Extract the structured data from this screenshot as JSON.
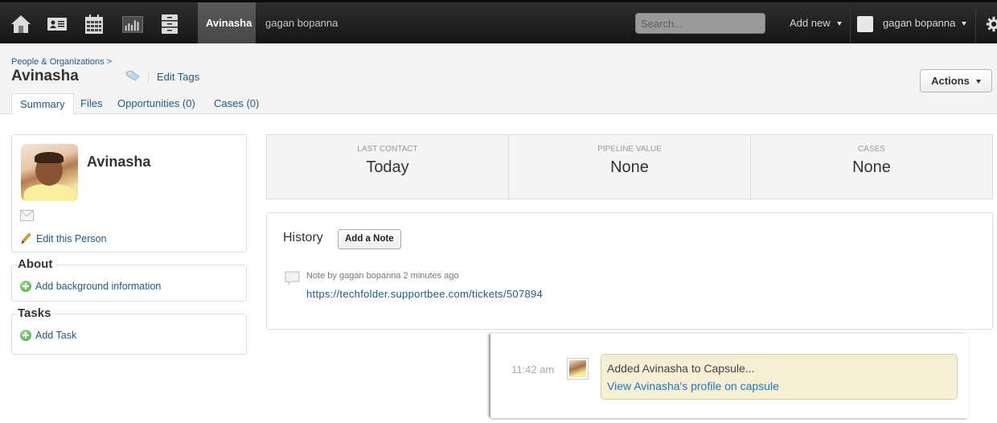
{
  "topbar": {
    "nav_icons": [
      "home-icon",
      "contacts-card-icon",
      "calendar-icon",
      "reports-chart-icon",
      "cases-cabinet-icon"
    ],
    "tabs": [
      {
        "label": "Avinasha",
        "active": true
      },
      {
        "label": "gagan bopanna",
        "active": false
      }
    ],
    "search_placeholder": "Search...",
    "add_new_label": "Add new",
    "user_label": "gagan bopanna",
    "settings_icon": "gear-icon"
  },
  "header": {
    "breadcrumb": "People & Organizations >",
    "title": "Avinasha",
    "edit_tags_label": "Edit Tags",
    "actions_label": "Actions"
  },
  "tabs": [
    {
      "label": "Summary",
      "active": true
    },
    {
      "label": "Files",
      "active": false
    },
    {
      "label": "Opportunities (0)",
      "active": false
    },
    {
      "label": "Cases (0)",
      "active": false
    }
  ],
  "person": {
    "name": "Avinasha",
    "edit_label": "Edit this Person"
  },
  "about": {
    "title": "About",
    "add_label": "Add background information"
  },
  "tasks": {
    "title": "Tasks",
    "add_label": "Add Task"
  },
  "stats": [
    {
      "label": "LAST CONTACT",
      "value": "Today"
    },
    {
      "label": "PIPELINE VALUE",
      "value": "None"
    },
    {
      "label": "CASES",
      "value": "None"
    }
  ],
  "history": {
    "title": "History",
    "add_note_label": "Add a Note",
    "notes": [
      {
        "meta": "Note by gagan bopanna 2 minutes ago",
        "link": "https://techfolder.supportbee.com/tickets/507894"
      }
    ]
  },
  "notification": {
    "time": "11:42 am",
    "message": "Added Avinasha to Capsule...",
    "link": "View Avinasha's profile on capsule",
    "bubble_color": "#f5efd3"
  }
}
